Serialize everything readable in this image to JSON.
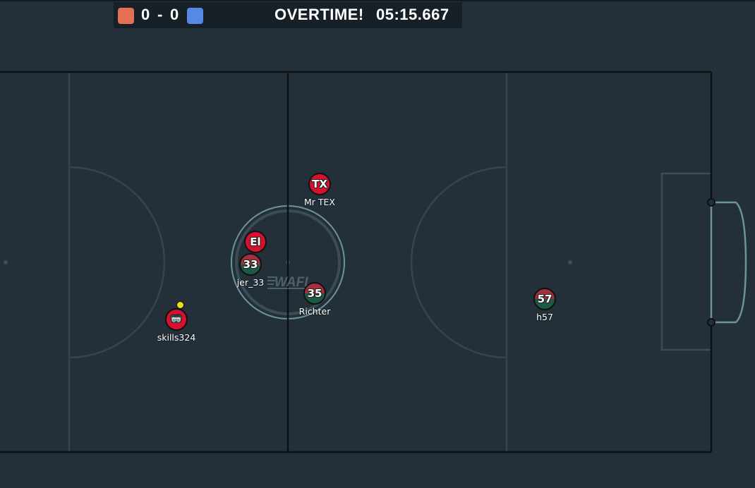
{
  "scoreboard": {
    "red_team_color": "#e56e56",
    "blue_team_color": "#5689e5",
    "red_score": "0",
    "separator": "-",
    "blue_score": "0",
    "status": "OVERTIME!",
    "clock": "05:15.667"
  },
  "field": {
    "logo_text": "WAFL",
    "line_color": "#34454f",
    "background": "#243039"
  },
  "players": [
    {
      "id": "mrtex",
      "avatar": "TX",
      "name": "Mr TEX",
      "team": "red",
      "style": "red"
    },
    {
      "id": "el",
      "avatar": "El",
      "name": "",
      "team": "red",
      "style": "red"
    },
    {
      "id": "jer33",
      "avatar": "33",
      "name": "jer_33",
      "team": "red",
      "style": "split"
    },
    {
      "id": "richter",
      "avatar": "35",
      "name": "Richter",
      "team": "red",
      "style": "split"
    },
    {
      "id": "skills324",
      "avatar": "🥽",
      "name": "skills324",
      "team": "red",
      "style": "red"
    },
    {
      "id": "h57",
      "avatar": "57",
      "name": "h57",
      "team": "red",
      "style": "split"
    }
  ],
  "ball": {
    "color": "#e6e21a"
  }
}
